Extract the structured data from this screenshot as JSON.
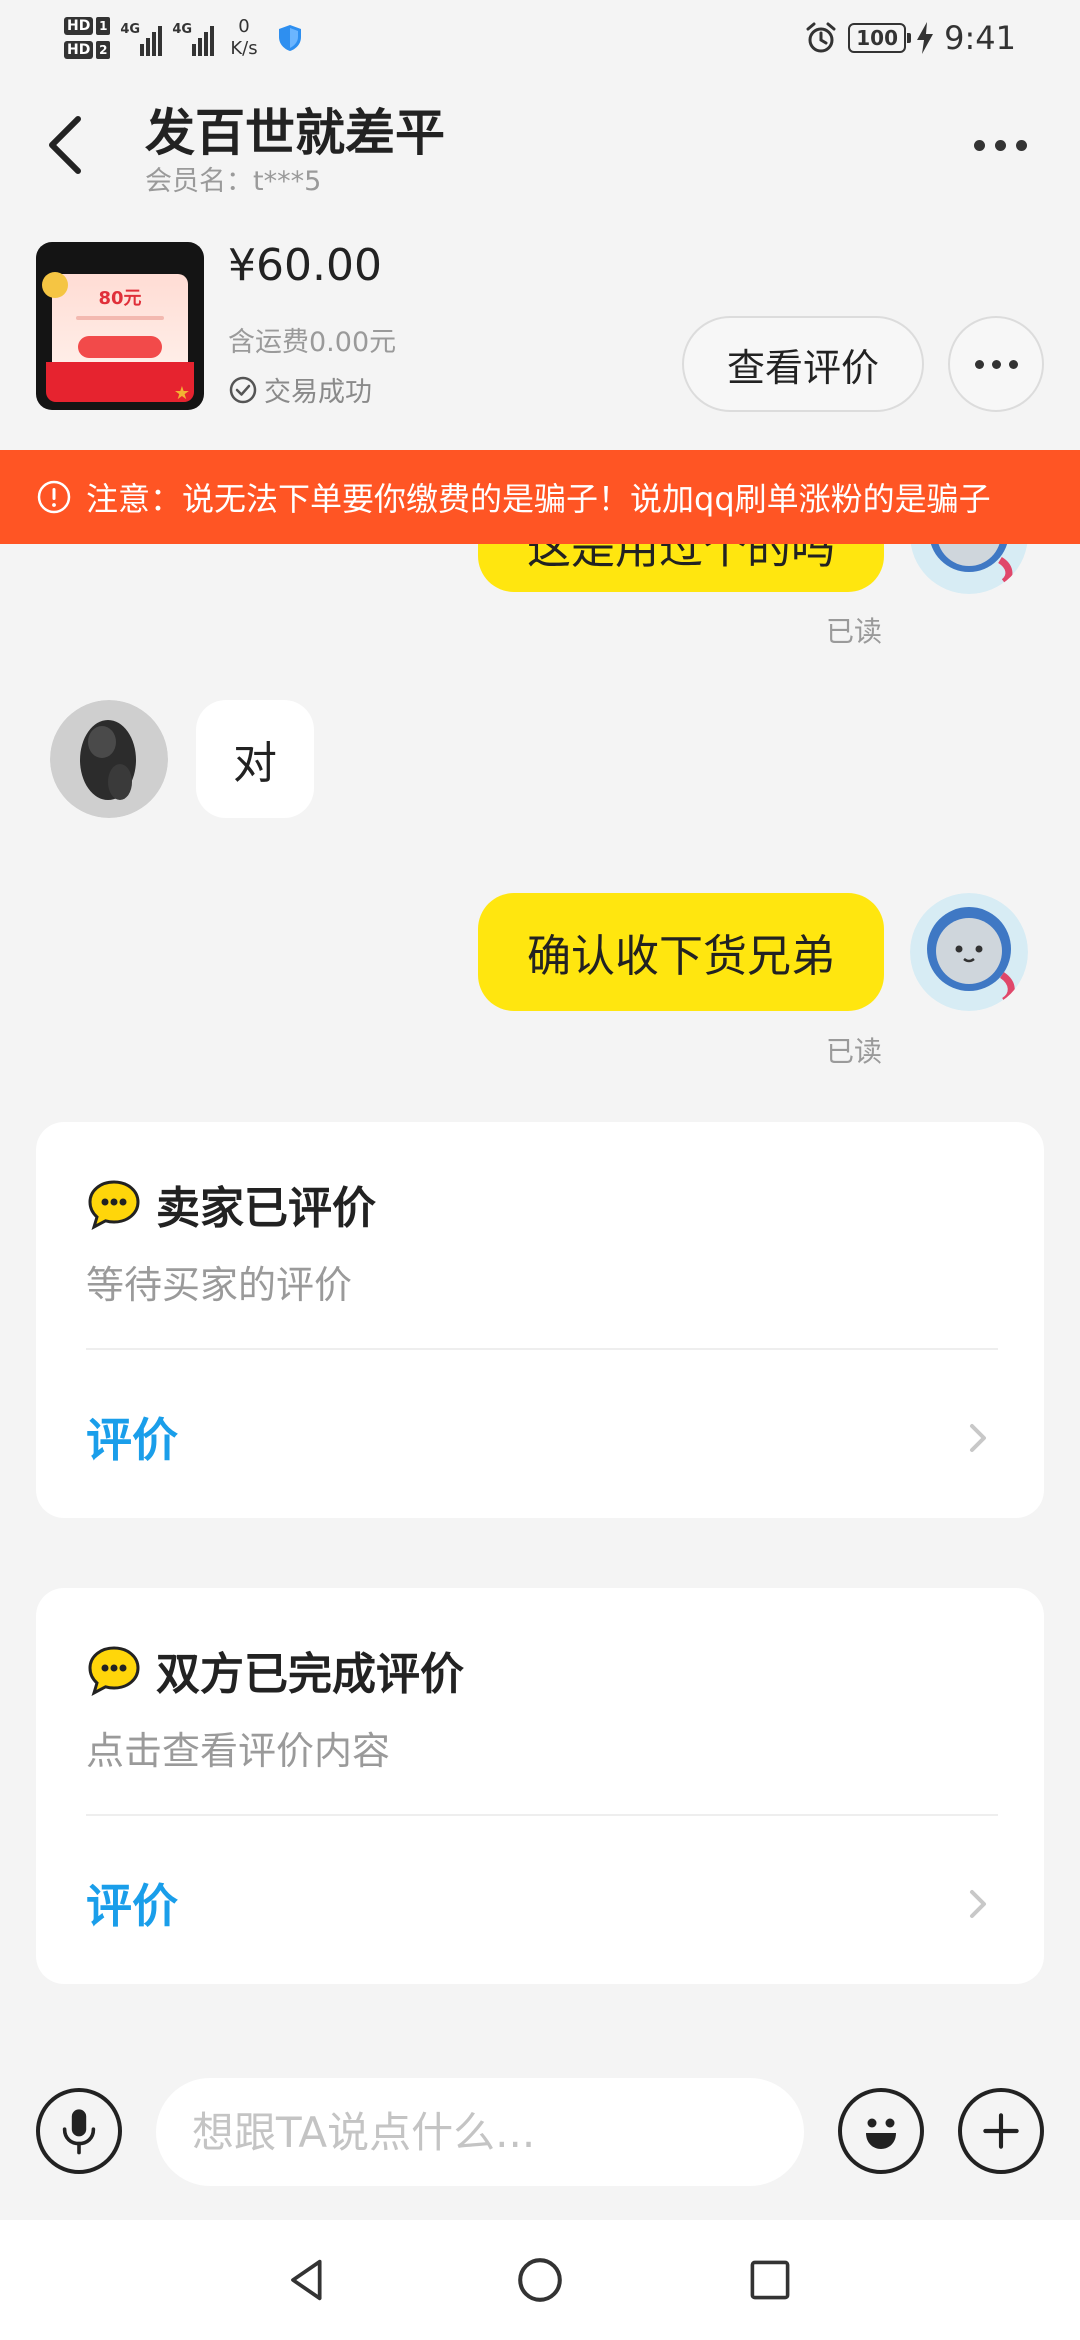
{
  "status_bar": {
    "hd1": "HD",
    "hd1_num": "1",
    "hd2": "HD",
    "hd2_num": "2",
    "net1": "4G",
    "net2": "4G",
    "speed_value": "0",
    "speed_unit": "K/s",
    "battery": "100",
    "time": "9:41",
    "icons": [
      "shield-icon",
      "alarm-icon",
      "charging-icon"
    ]
  },
  "header": {
    "title": "发百世就差平",
    "member": "会员名：t***5",
    "back_icon": "chevron-left-icon",
    "more_icon": "more-dots-icon"
  },
  "product": {
    "thumb_amount": "80元",
    "price": "¥60.00",
    "shipping": "含运费0.00元",
    "status": "交易成功",
    "review_button": "查看评价"
  },
  "warning": {
    "text": "注意：说无法下单要你缴费的是骗子！说加qq刷单涨粉的是骗子"
  },
  "messages": [
    {
      "side": "right",
      "text": "这是用过个的吗",
      "read": "已读"
    },
    {
      "side": "left",
      "text": "对"
    },
    {
      "side": "right",
      "text": "确认收下货兄弟",
      "read": "已读"
    }
  ],
  "evaluations": [
    {
      "title": "卖家已评价",
      "subtitle": "等待买家的评价",
      "link": "评价"
    },
    {
      "title": "双方已完成评价",
      "subtitle": "点击查看评价内容",
      "link": "评价"
    }
  ],
  "input": {
    "placeholder": "想跟TA说点什么..."
  },
  "colors": {
    "accent_yellow": "#ffe60f",
    "warning_orange": "#ff5524",
    "link_blue": "#1a9eea"
  }
}
